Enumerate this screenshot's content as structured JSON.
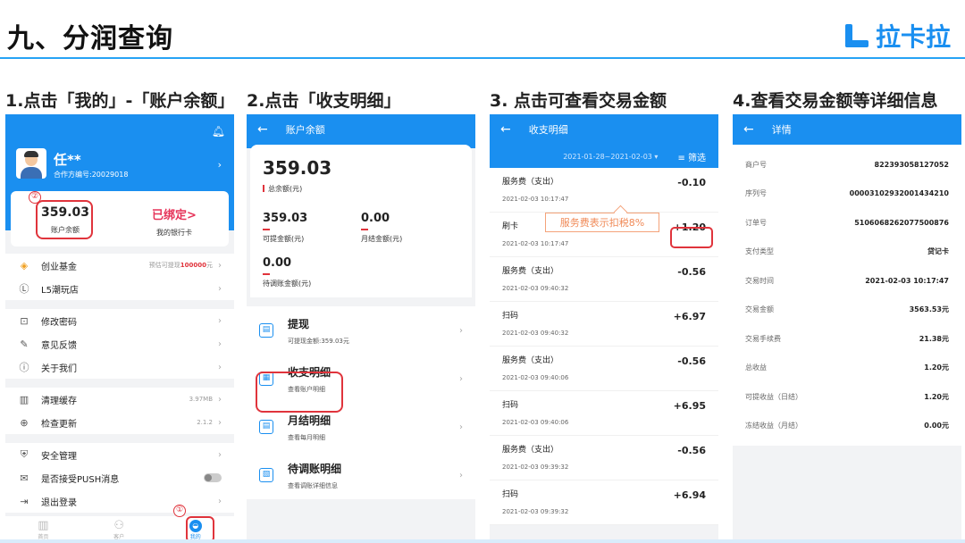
{
  "slide": {
    "title": "九、分润查询",
    "logo_text": "拉卡拉",
    "steps": [
      "1.点击「我的」-「账户余额」",
      "2.点击「收支明细」",
      "3. 点击可查看交易金额",
      "4.查看交易金额等详细信息"
    ]
  },
  "phone1": {
    "user_name": "任**",
    "partner_id": "合作方编号:20029018",
    "balance_value": "359.03",
    "balance_label": "账户余额",
    "bank_status": "已绑定>",
    "bank_label": "我的银行卡",
    "marker_one": "①",
    "marker_two": "②",
    "menu": [
      {
        "icon": "coins-icon",
        "glyph": "◈",
        "label": "创业基金",
        "extra_prefix": "预估可提现",
        "extra_value": "100000",
        "extra_suffix": "元"
      },
      {
        "icon": "l5-icon",
        "glyph": "Ⓛ",
        "label": "L5潮玩店"
      },
      {
        "icon": "lock-icon",
        "glyph": "⊡",
        "label": "修改密码"
      },
      {
        "icon": "feedback-icon",
        "glyph": "✎",
        "label": "意见反馈"
      },
      {
        "icon": "about-icon",
        "glyph": "ⓘ",
        "label": "关于我们"
      },
      {
        "icon": "trash-icon",
        "glyph": "▥",
        "label": "清理缓存",
        "extra": "3.97MB"
      },
      {
        "icon": "update-icon",
        "glyph": "⊕",
        "label": "检查更新",
        "extra": "2.1.2"
      },
      {
        "icon": "shield-icon",
        "glyph": "⛨",
        "label": "安全管理"
      },
      {
        "icon": "mail-icon",
        "glyph": "✉",
        "label": "是否接受PUSH消息"
      },
      {
        "icon": "logout-icon",
        "glyph": "⇥",
        "label": "退出登录"
      }
    ],
    "tabs": [
      "首页",
      "客户",
      "我的"
    ]
  },
  "phone2": {
    "bar_title": "账户余额",
    "total_value": "359.03",
    "total_label": "总余额(元)",
    "withdrawable_value": "359.03",
    "withdrawable_label": "可提金额(元)",
    "monthly_value": "0.00",
    "monthly_label": "月结金额(元)",
    "pending_value": "0.00",
    "pending_label": "待调账金额(元)",
    "list": [
      {
        "icon": "withdraw-icon",
        "glyph": "▤",
        "title": "提现",
        "sub": "可提现金额:359.03元"
      },
      {
        "icon": "statement-icon",
        "glyph": "▦",
        "title": "收支明细",
        "sub": "查看账户明细"
      },
      {
        "icon": "monthly-icon",
        "glyph": "▤",
        "title": "月结明细",
        "sub": "查看每月明细"
      },
      {
        "icon": "adjust-icon",
        "glyph": "▧",
        "title": "待调账明细",
        "sub": "查看调账详细信息"
      }
    ]
  },
  "phone3": {
    "bar_title": "收支明细",
    "date_range": "2021-01-28~2021-02-03 ▾",
    "filter_label": "≡ 筛选",
    "note": "服务费表示扣税8%",
    "transactions": [
      {
        "name": "服务费（支出）",
        "time": "2021-02-03 10:17:47",
        "amount": "-0.10"
      },
      {
        "name": "刷卡",
        "time": "2021-02-03 10:17:47",
        "amount": "+1.20"
      },
      {
        "name": "服务费（支出）",
        "time": "2021-02-03 09:40:32",
        "amount": "-0.56"
      },
      {
        "name": "扫码",
        "time": "2021-02-03 09:40:32",
        "amount": "+6.97"
      },
      {
        "name": "服务费（支出）",
        "time": "2021-02-03 09:40:06",
        "amount": "-0.56"
      },
      {
        "name": "扫码",
        "time": "2021-02-03 09:40:06",
        "amount": "+6.95"
      },
      {
        "name": "服务费（支出）",
        "time": "2021-02-03 09:39:32",
        "amount": "-0.56"
      },
      {
        "name": "扫码",
        "time": "2021-02-03 09:39:32",
        "amount": "+6.94"
      }
    ]
  },
  "phone4": {
    "bar_title": "详情",
    "details": [
      {
        "key": "商户号",
        "value": "822393058127052"
      },
      {
        "key": "序列号",
        "value": "00003102932001434210"
      },
      {
        "key": "订单号",
        "value": "5106068262077500876"
      },
      {
        "key": "支付类型",
        "value": "贷记卡"
      },
      {
        "key": "交易时间",
        "value": "2021-02-03 10:17:47"
      },
      {
        "key": "交易金额",
        "value": "3563.53元"
      },
      {
        "key": "交易手续费",
        "value": "21.38元"
      },
      {
        "key": "总收益",
        "value": "1.20元"
      },
      {
        "key": "可提收益（日结）",
        "value": "1.20元"
      },
      {
        "key": "冻结收益（月结）",
        "value": "0.00元"
      }
    ]
  },
  "colors": {
    "accent": "#1a8ff0",
    "highlight": "#e0343c",
    "note": "#f08a57"
  }
}
